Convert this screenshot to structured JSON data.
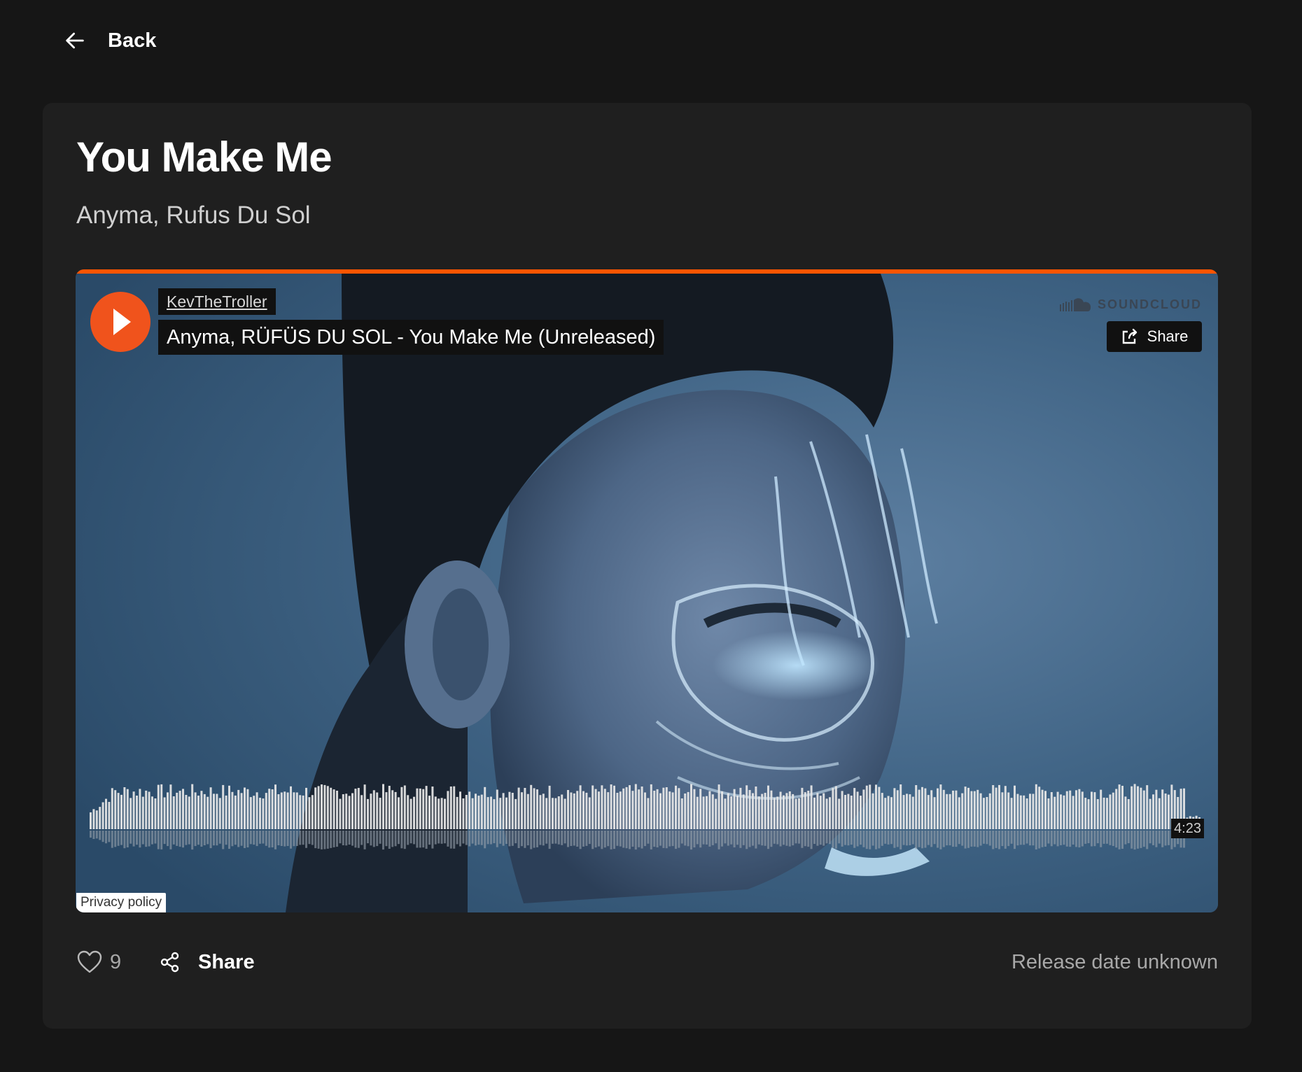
{
  "nav": {
    "back_label": "Back",
    "back_icon": "arrow-left-icon"
  },
  "track": {
    "title": "You Make Me",
    "artists": "Anyma, Rufus Du Sol"
  },
  "embed": {
    "provider": "SOUNDCLOUD",
    "provider_icon": "soundcloud-logo-icon",
    "accent_color": "#ff5500",
    "uploader": "KevTheTroller",
    "track_title": "Anyma, RÜFÜS DU SOL - You Make Me (Unreleased)",
    "share_label": "Share",
    "share_icon": "share-out-icon",
    "play_icon": "play-icon",
    "duration": "4:23",
    "privacy_label": "Privacy policy",
    "artwork_description": "portrait-artwork"
  },
  "footer": {
    "like_icon": "heart-outline-icon",
    "like_count": "9",
    "share_icon": "share-nodes-icon",
    "share_label": "Share",
    "release_text": "Release date unknown"
  },
  "colors": {
    "page_bg": "#161616",
    "card_bg": "#1f1f1f",
    "play_button": "#f0531c",
    "muted_text": "#a8a8a8"
  }
}
